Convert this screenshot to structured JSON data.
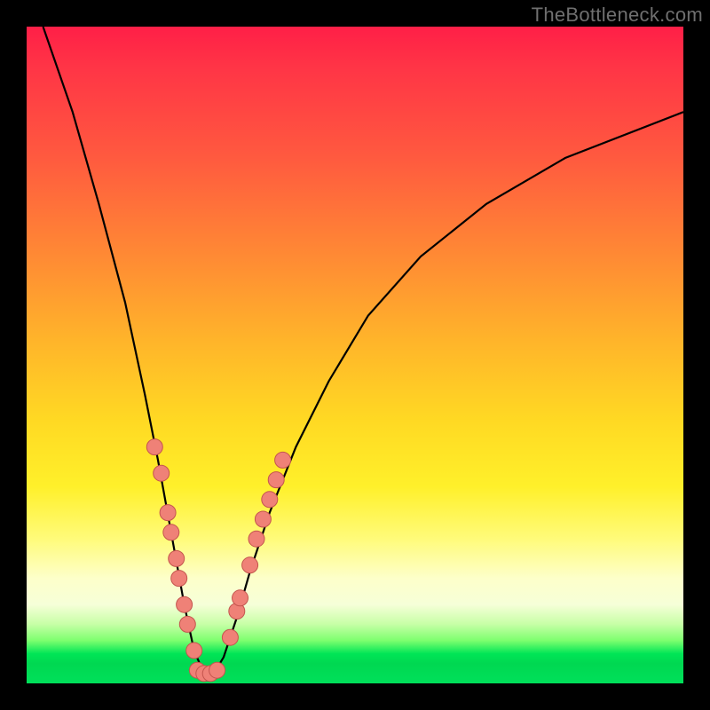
{
  "watermark": "TheBottleneck.com",
  "colors": {
    "background": "#000000",
    "curve_stroke": "#000000",
    "marker_fill": "#ef8177",
    "marker_stroke": "#c4554e"
  },
  "chart_data": {
    "type": "line",
    "title": "",
    "xlabel": "",
    "ylabel": "",
    "xlim": [
      0,
      100
    ],
    "ylim": [
      0,
      100
    ],
    "grid": false,
    "legend": false,
    "description": "Bottleneck-style V curve: a single black curve that plunges from top-left, reaches a minimum near the bottom at roughly x≈27, then rises shallowly toward the upper-right. Several salmon/coral circular markers sit on both flanks of the valley in the lower third of the plot area; a small cluster sits at the valley floor. Background is a vertical rainbow gradient (red at top through orange/yellow to a narrow green strip at the bottom).",
    "curve_points": [
      {
        "x": 2.5,
        "y": 100
      },
      {
        "x": 7,
        "y": 87
      },
      {
        "x": 11,
        "y": 73
      },
      {
        "x": 15,
        "y": 58
      },
      {
        "x": 18,
        "y": 44
      },
      {
        "x": 20,
        "y": 34
      },
      {
        "x": 22,
        "y": 23
      },
      {
        "x": 24,
        "y": 12
      },
      {
        "x": 25.5,
        "y": 5
      },
      {
        "x": 27,
        "y": 1.5
      },
      {
        "x": 28.5,
        "y": 1.5
      },
      {
        "x": 30,
        "y": 4
      },
      {
        "x": 32,
        "y": 10
      },
      {
        "x": 34,
        "y": 17
      },
      {
        "x": 37,
        "y": 26
      },
      {
        "x": 41,
        "y": 36
      },
      {
        "x": 46,
        "y": 46
      },
      {
        "x": 52,
        "y": 56
      },
      {
        "x": 60,
        "y": 65
      },
      {
        "x": 70,
        "y": 73
      },
      {
        "x": 82,
        "y": 80
      },
      {
        "x": 100,
        "y": 87
      }
    ],
    "markers": [
      {
        "x": 19.5,
        "y": 36
      },
      {
        "x": 20.5,
        "y": 32
      },
      {
        "x": 21.5,
        "y": 26
      },
      {
        "x": 22,
        "y": 23
      },
      {
        "x": 22.8,
        "y": 19
      },
      {
        "x": 23.2,
        "y": 16
      },
      {
        "x": 24,
        "y": 12
      },
      {
        "x": 24.5,
        "y": 9
      },
      {
        "x": 25.5,
        "y": 5
      },
      {
        "x": 26,
        "y": 2
      },
      {
        "x": 27,
        "y": 1.5
      },
      {
        "x": 28,
        "y": 1.5
      },
      {
        "x": 29,
        "y": 2
      },
      {
        "x": 31,
        "y": 7
      },
      {
        "x": 32,
        "y": 11
      },
      {
        "x": 32.5,
        "y": 13
      },
      {
        "x": 34,
        "y": 18
      },
      {
        "x": 35,
        "y": 22
      },
      {
        "x": 36,
        "y": 25
      },
      {
        "x": 37,
        "y": 28
      },
      {
        "x": 38,
        "y": 31
      },
      {
        "x": 39,
        "y": 34
      }
    ]
  }
}
